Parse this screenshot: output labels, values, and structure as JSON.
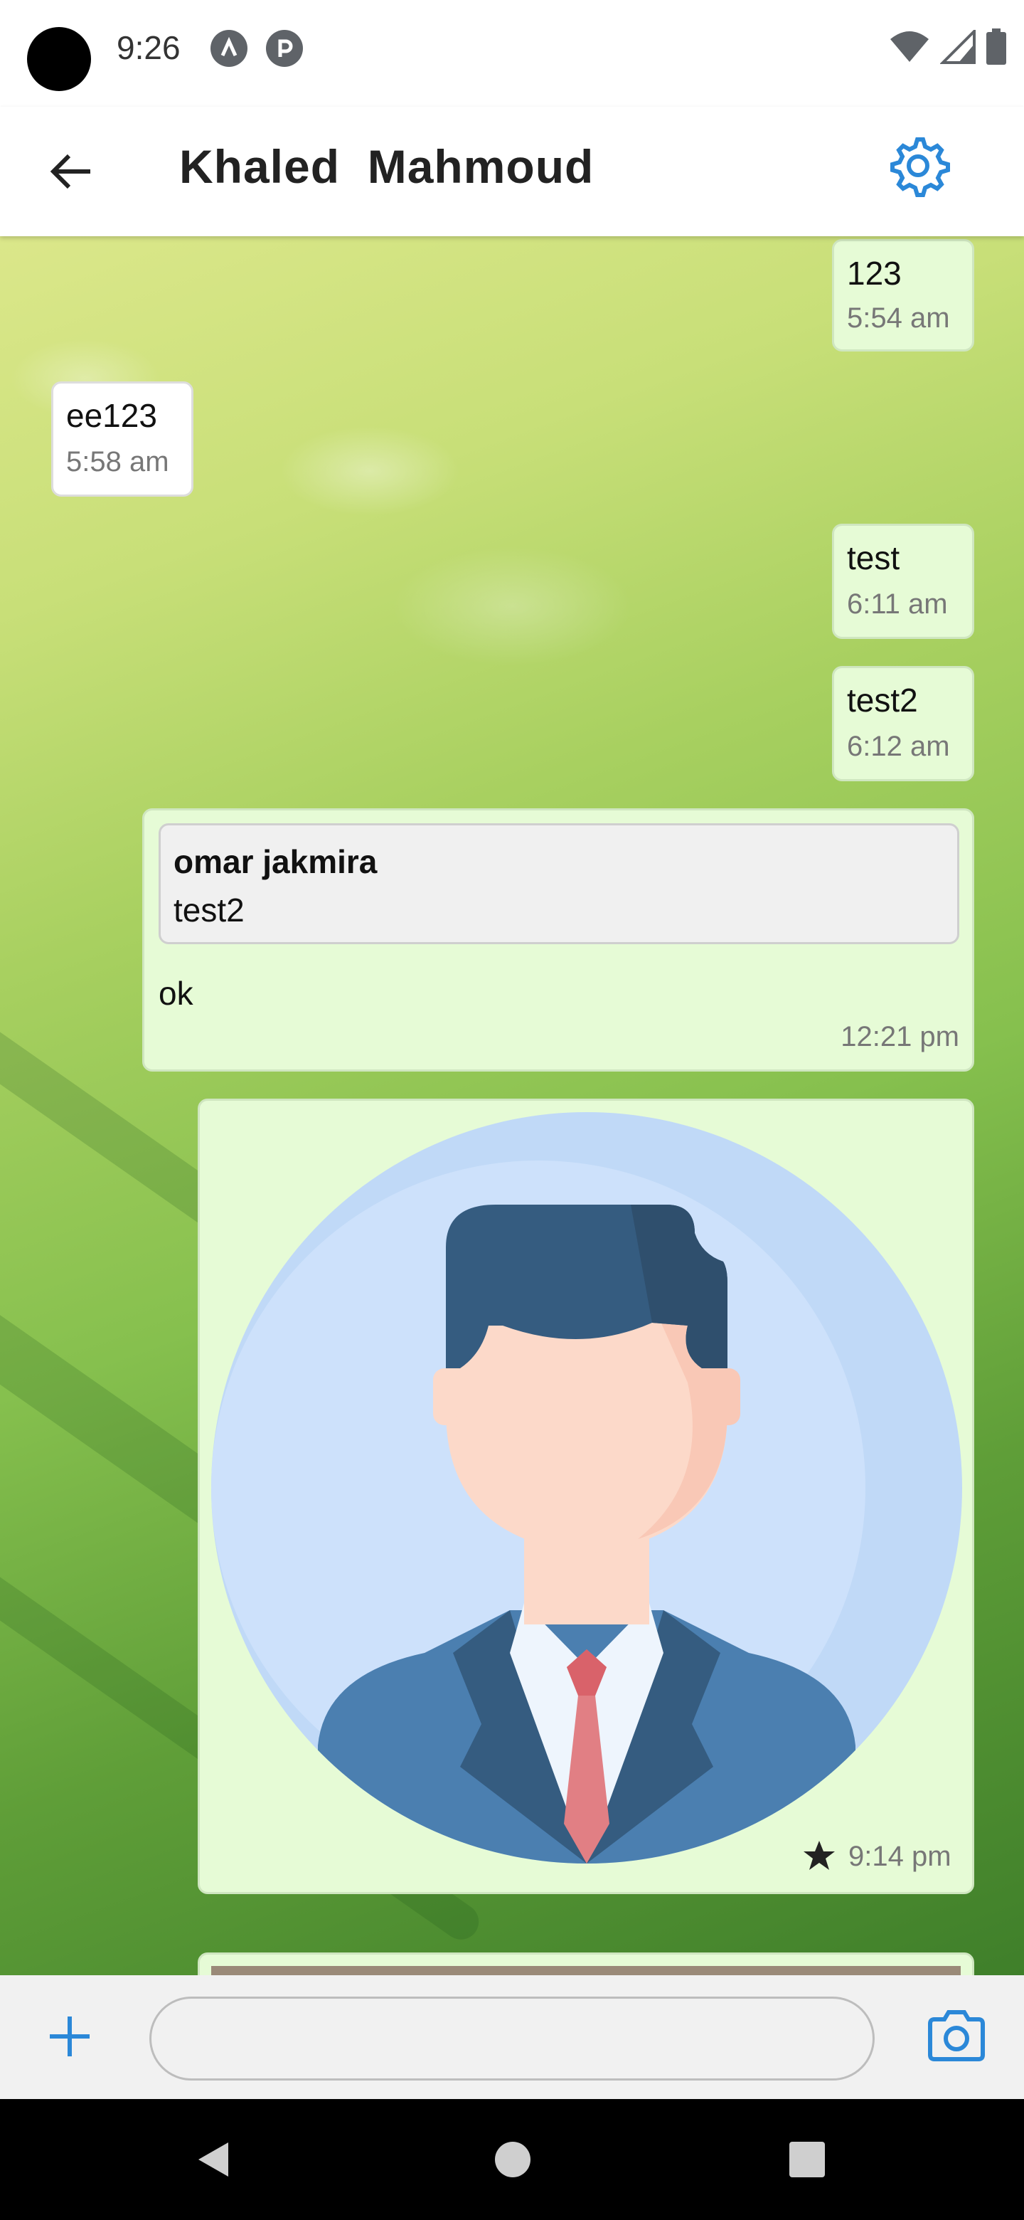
{
  "status_bar": {
    "time": "9:26",
    "icons": [
      "a-icon",
      "p-icon",
      "wifi-icon",
      "signal-icon",
      "battery-icon"
    ]
  },
  "header": {
    "title": "Khaled  Mahmoud",
    "icons": [
      "back-arrow-icon",
      "gear-icon"
    ],
    "accent_color": "#2b88d8"
  },
  "messages": [
    {
      "direction": "out",
      "text": "123",
      "time": "5:54 am"
    },
    {
      "direction": "in",
      "text": "ee123",
      "time": "5:58 am"
    },
    {
      "direction": "out",
      "text": "test",
      "time": "6:11 am"
    },
    {
      "direction": "out",
      "text": "test2",
      "time": "6:12 am"
    },
    {
      "direction": "out",
      "reply": {
        "name": "omar jakmira",
        "text": "test2"
      },
      "text": "ok",
      "time": "12:21 pm"
    },
    {
      "direction": "out",
      "type": "image",
      "image": "person-avatar-illustration",
      "starred": true,
      "time": "9:14 pm"
    }
  ],
  "input_bar": {
    "placeholder": "",
    "icons": [
      "plus-icon",
      "camera-icon"
    ]
  },
  "nav_bar": {
    "icons": [
      "back-triangle-icon",
      "home-circle-icon",
      "recents-square-icon"
    ]
  },
  "colors": {
    "outgoing_bubble": "#e6fbd6",
    "incoming_bubble": "#ffffff",
    "accent": "#2b88d8"
  }
}
